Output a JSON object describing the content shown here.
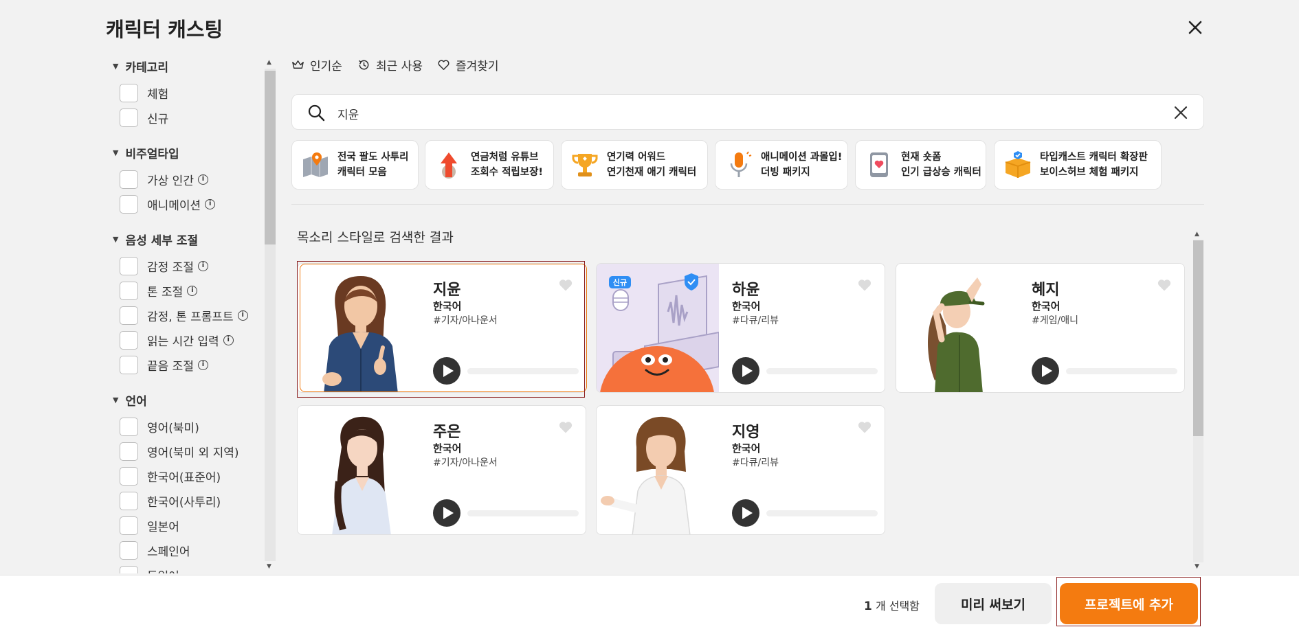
{
  "dialog": {
    "title": "캐릭터 캐스팅"
  },
  "sidebar": {
    "sections": [
      {
        "label": "카테고리",
        "options": [
          {
            "label": "체험",
            "info": false
          },
          {
            "label": "신규",
            "info": false
          }
        ]
      },
      {
        "label": "비주얼타입",
        "options": [
          {
            "label": "가상 인간",
            "info": true
          },
          {
            "label": "애니메이션",
            "info": true
          }
        ]
      },
      {
        "label": "음성 세부 조절",
        "options": [
          {
            "label": "감정 조절",
            "info": true
          },
          {
            "label": "톤 조절",
            "info": true
          },
          {
            "label": "감정, 톤 프롬프트",
            "info": true
          },
          {
            "label": "읽는 시간 입력",
            "info": true
          },
          {
            "label": "끝음 조절",
            "info": true
          }
        ]
      },
      {
        "label": "언어",
        "options": [
          {
            "label": "영어(북미)",
            "info": false
          },
          {
            "label": "영어(북미 외 지역)",
            "info": false
          },
          {
            "label": "한국어(표준어)",
            "info": false
          },
          {
            "label": "한국어(사투리)",
            "info": false
          },
          {
            "label": "일본어",
            "info": false
          },
          {
            "label": "스페인어",
            "info": false
          },
          {
            "label": "독일어",
            "info": false
          }
        ]
      }
    ]
  },
  "sort": {
    "popular": "인기순",
    "recent": "최근 사용",
    "favorites": "즐겨찾기"
  },
  "search": {
    "value": "지윤"
  },
  "chips": [
    {
      "line1": "전국 팔도 사투리",
      "line2": "캐릭터 모음",
      "icon": "map-pin-icon"
    },
    {
      "line1": "연금처럼 유튜브",
      "line2": "조회수 적립보장!",
      "icon": "growth-arrow-icon"
    },
    {
      "line1": "연기력 어워드",
      "line2": "연기천재 애기 캐릭터",
      "icon": "trophy-icon"
    },
    {
      "line1": "애니메이션 과몰입!",
      "line2": "더빙 패키지",
      "icon": "microphone-icon"
    },
    {
      "line1": "현재 숏폼",
      "line2": "인기 급상승 캐릭터",
      "icon": "phone-heart-icon"
    },
    {
      "line1": "타입캐스트 캐릭터 확장판",
      "line2": "보이스허브 체험 패키지",
      "icon": "gift-box-icon"
    }
  ],
  "results": {
    "title": "목소리 스타일로 검색한 결과",
    "cards": [
      {
        "name": "지윤",
        "lang": "한국어",
        "tag": "#기자/아나운서",
        "selected": true
      },
      {
        "name": "하윤",
        "lang": "한국어",
        "tag": "#다큐/리뷰",
        "badge": "신규"
      },
      {
        "name": "혜지",
        "lang": "한국어",
        "tag": "#게임/애니"
      },
      {
        "name": "주은",
        "lang": "한국어",
        "tag": "#기자/아나운서"
      },
      {
        "name": "지영",
        "lang": "한국어",
        "tag": "#다큐/리뷰"
      }
    ]
  },
  "footer": {
    "count": "1",
    "count_suffix": "개 선택함",
    "preview_label": "미리 써보기",
    "add_label": "프로젝트에 추가"
  },
  "colors": {
    "accent": "#f47b10",
    "selection_outline": "#8a1d1d"
  }
}
